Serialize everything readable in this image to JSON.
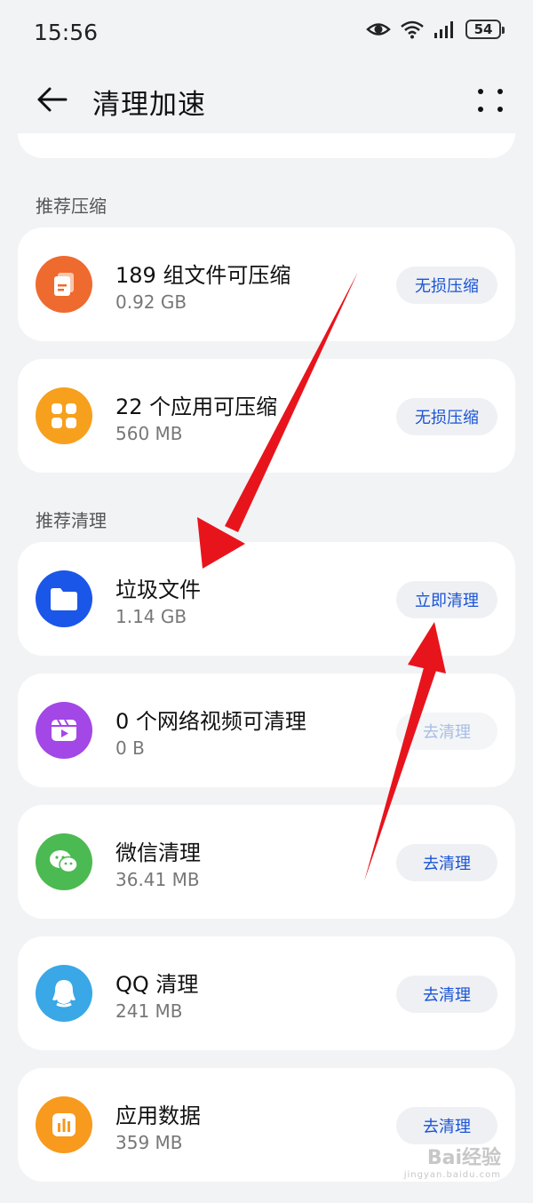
{
  "status_bar": {
    "time": "15:56",
    "battery": "54",
    "icons": [
      "eye-icon",
      "wifi-icon",
      "signal-icon",
      "battery-icon"
    ]
  },
  "header": {
    "title": "清理加速",
    "back_icon": "back-arrow-icon",
    "more_icon": "more-icon"
  },
  "sections": {
    "compress_title": "推荐压缩",
    "clean_title": "推荐清理"
  },
  "compress_items": [
    {
      "title": "189 组文件可压缩",
      "size": "0.92 GB",
      "action": "无损压缩",
      "icon": "documents-icon",
      "color": "#ef6a2f"
    },
    {
      "title": "22 个应用可压缩",
      "size": "560 MB",
      "action": "无损压缩",
      "icon": "apps-grid-icon",
      "color": "#f7a01d"
    }
  ],
  "clean_items": [
    {
      "title": "垃圾文件",
      "size": "1.14 GB",
      "action": "立即清理",
      "icon": "folder-icon",
      "color": "#1a56e8"
    },
    {
      "title": "0 个网络视频可清理",
      "size": "0 B",
      "action": "去清理",
      "icon": "video-icon",
      "color": "#a347e6",
      "disabled": true
    },
    {
      "title": "微信清理",
      "size": "36.41 MB",
      "action": "去清理",
      "icon": "wechat-icon",
      "color": "#4cba52"
    },
    {
      "title": "QQ 清理",
      "size": "241 MB",
      "action": "去清理",
      "icon": "qq-icon",
      "color": "#3aa7e6"
    },
    {
      "title": "应用数据",
      "size": "359 MB",
      "action": "去清理",
      "icon": "app-data-icon",
      "color": "#f79a1d"
    }
  ],
  "annotations": {
    "arrow_color": "#e8141c"
  },
  "watermark": {
    "brand": "Bai经验",
    "url": "jingyan.baidu.com"
  }
}
